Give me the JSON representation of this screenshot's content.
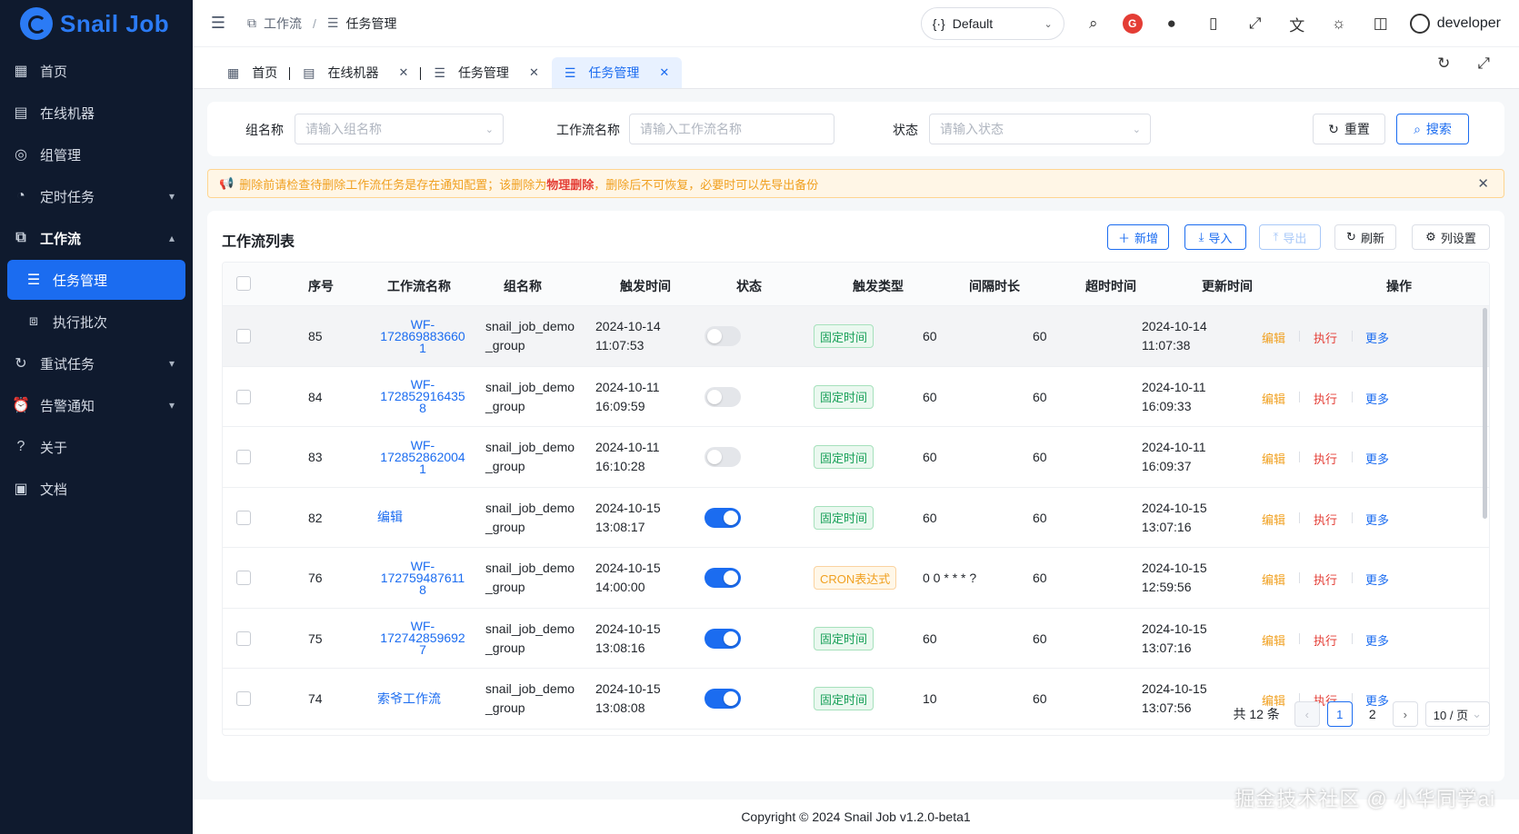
{
  "app": {
    "logo_text": "Snail Job"
  },
  "sidebar": {
    "items": [
      {
        "label": "首页",
        "icon": "dashboard-icon"
      },
      {
        "label": "在线机器",
        "icon": "server-icon"
      },
      {
        "label": "组管理",
        "icon": "group-icon"
      },
      {
        "label": "定时任务",
        "icon": "timer-icon"
      },
      {
        "label": "工作流",
        "icon": "workflow-icon"
      },
      {
        "label": "任务管理",
        "icon": "task-list-icon"
      },
      {
        "label": "执行批次",
        "icon": "batch-icon"
      },
      {
        "label": "重试任务",
        "icon": "retry-icon"
      },
      {
        "label": "告警通知",
        "icon": "alarm-icon"
      },
      {
        "label": "关于",
        "icon": "help-icon"
      },
      {
        "label": "文档",
        "icon": "document-icon"
      }
    ]
  },
  "header": {
    "breadcrumb": [
      "工作流",
      "任务管理"
    ],
    "namespace": "Default",
    "user": "developer"
  },
  "tabs": [
    {
      "label": "首页"
    },
    {
      "label": "在线机器"
    },
    {
      "label": "任务管理"
    },
    {
      "label": "任务管理"
    }
  ],
  "search": {
    "group_label": "组名称",
    "group_placeholder": "请输入组名称",
    "name_label": "工作流名称",
    "name_placeholder": "请输入工作流名称",
    "status_label": "状态",
    "status_placeholder": "请输入状态",
    "reset": "重置",
    "search": "搜索"
  },
  "alert": {
    "prefix": "删除前请检查待删除工作流任务是存在通知配置；该删除为",
    "strong": "物理删除",
    "suffix": "，删除后不可恢复，必要时可以先导出备份"
  },
  "table": {
    "title": "工作流列表",
    "toolbar": {
      "add": "新增",
      "import": "导入",
      "export": "导出",
      "refresh": "刷新",
      "columns": "列设置"
    },
    "headers": [
      "序号",
      "工作流名称",
      "组名称",
      "触发时间",
      "状态",
      "触发类型",
      "间隔时长",
      "超时时间",
      "更新时间",
      "操作"
    ],
    "ops": {
      "edit": "编辑",
      "exec": "执行",
      "more": "更多"
    },
    "rows": [
      {
        "id": "85",
        "name": [
          "WF-",
          "172869883660",
          "1"
        ],
        "group": [
          "snail_job_demo",
          "_group"
        ],
        "trigger_time": [
          "2024-10-14",
          "11:07:53"
        ],
        "enabled": false,
        "type": "固定时间",
        "type_color": "green",
        "interval": "60",
        "timeout": "60",
        "updated": [
          "2024-10-14",
          "11:07:38"
        ]
      },
      {
        "id": "84",
        "name": [
          "WF-",
          "172852916435",
          "8"
        ],
        "group": [
          "snail_job_demo",
          "_group"
        ],
        "trigger_time": [
          "2024-10-11",
          "16:09:59"
        ],
        "enabled": false,
        "type": "固定时间",
        "type_color": "green",
        "interval": "60",
        "timeout": "60",
        "updated": [
          "2024-10-11",
          "16:09:33"
        ]
      },
      {
        "id": "83",
        "name": [
          "WF-",
          "172852862004",
          "1"
        ],
        "group": [
          "snail_job_demo",
          "_group"
        ],
        "trigger_time": [
          "2024-10-11",
          "16:10:28"
        ],
        "enabled": false,
        "type": "固定时间",
        "type_color": "green",
        "interval": "60",
        "timeout": "60",
        "updated": [
          "2024-10-11",
          "16:09:37"
        ]
      },
      {
        "id": "82",
        "name": [
          "编辑"
        ],
        "group": [
          "snail_job_demo",
          "_group"
        ],
        "trigger_time": [
          "2024-10-15",
          "13:08:17"
        ],
        "enabled": true,
        "type": "固定时间",
        "type_color": "green",
        "interval": "60",
        "timeout": "60",
        "updated": [
          "2024-10-15",
          "13:07:16"
        ]
      },
      {
        "id": "76",
        "name": [
          "WF-",
          "172759487611",
          "8"
        ],
        "group": [
          "snail_job_demo",
          "_group"
        ],
        "trigger_time": [
          "2024-10-15",
          "14:00:00"
        ],
        "enabled": true,
        "type": "CRON表达式",
        "type_color": "orange",
        "interval": "0 0 * * * ?",
        "timeout": "60",
        "updated": [
          "2024-10-15",
          "12:59:56"
        ]
      },
      {
        "id": "75",
        "name": [
          "WF-",
          "172742859692",
          "7"
        ],
        "group": [
          "snail_job_demo",
          "_group"
        ],
        "trigger_time": [
          "2024-10-15",
          "13:08:16"
        ],
        "enabled": true,
        "type": "固定时间",
        "type_color": "green",
        "interval": "60",
        "timeout": "60",
        "updated": [
          "2024-10-15",
          "13:07:16"
        ]
      },
      {
        "id": "74",
        "name": [
          "索爷工作流"
        ],
        "group": [
          "snail_job_demo",
          "_group"
        ],
        "trigger_time": [
          "2024-10-15",
          "13:08:08"
        ],
        "enabled": true,
        "type": "固定时间",
        "type_color": "green",
        "interval": "10",
        "timeout": "60",
        "updated": [
          "2024-10-15",
          "13:07:56"
        ]
      }
    ]
  },
  "pagination": {
    "total": "共 12 条",
    "pages": [
      "1",
      "2"
    ],
    "current": "1",
    "page_size": "10 / 页"
  },
  "footer": "Copyright © 2024 Snail Job v1.2.0-beta1",
  "watermark": "掘金技术社区 @ 小华同学ai",
  "colors": {
    "primary": "#1b6cf0",
    "sidebar_bg": "#0f1a2e",
    "warning": "#f0a020",
    "danger": "#e43d35",
    "success": "#18a058"
  }
}
